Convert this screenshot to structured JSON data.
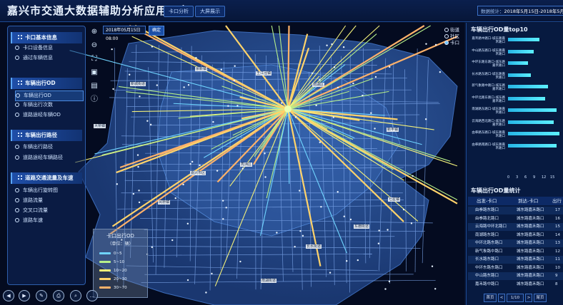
{
  "header": {
    "title": "嘉兴市交通大数据辅助分析应用平台",
    "buttons": [
      "卡口分析",
      "大屏展示"
    ],
    "stats_label": "数据统计：",
    "stats_value": "2018年5月15日-2018年5月21日"
  },
  "sidebar": {
    "sections": [
      {
        "title": "卡口基本信息",
        "items": [
          "卡口设备信息",
          "通过车辆信息"
        ]
      },
      {
        "title": "车辆出行OD",
        "items": [
          "车辆出行OD",
          "车辆出行次数",
          "道路途经车辆OD"
        ]
      },
      {
        "title": "车辆出行路径",
        "items": [
          "车辆出行路径",
          "道路途经车辆路径"
        ]
      },
      {
        "title": "道路交通流量及车速",
        "items": [
          "车辆出行旋转图",
          "道路流量",
          "交叉口流量",
          "道路车速"
        ]
      }
    ],
    "active_item": "车辆出行OD"
  },
  "toolbar": {
    "tools": [
      "zoom-in-icon",
      "zoom-out-icon",
      "fullscreen-icon",
      "image-icon",
      "document-icon",
      "info-icon"
    ]
  },
  "time_picker": {
    "value": "2018年05月15日08:00",
    "confirm_label": "确定"
  },
  "map": {
    "radio_options": [
      "街道",
      "社区",
      "卡口"
    ],
    "radio_selected": "卡口",
    "labels": [
      "余新镇",
      "王江泾镇",
      "新城街道",
      "南湖区",
      "大桥镇",
      "新丰镇",
      "秀洲区",
      "嘉兴市区",
      "凤桥镇",
      "七星镇",
      "东栅街道",
      "长水街道",
      "南湖街道"
    ]
  },
  "legend": {
    "title": "卡口出行OD",
    "unit": "（单位：辆）",
    "items": [
      {
        "label": "0~5",
        "color": "#6fd4ff"
      },
      {
        "label": "5~10",
        "color": "#b6f08a"
      },
      {
        "label": "10~20",
        "color": "#f2f07a"
      },
      {
        "label": "20~30",
        "color": "#ffd36a"
      },
      {
        "label": "30~70",
        "color": "#ffb26a"
      }
    ]
  },
  "bottom_controls": [
    "prev-icon",
    "play-icon",
    "edit-icon",
    "print-icon",
    "search-icon",
    "more-icon"
  ],
  "top10_panel": {
    "title": "车辆出行OD量top10"
  },
  "chart_data": {
    "type": "bar",
    "orientation": "horizontal",
    "title": "车辆出行OD量top10",
    "categories": [
      "嘉禾路中路口-城东路嘉禾路口",
      "中山路东路口-城东路嘉禾路口",
      "中环东路东路口-城东路嘉禾路口",
      "长水路东路口-城东路嘉禾路口",
      "新气象路中路口-城东路嘉禾路口",
      "中环北路东路口-城东路嘉禾路口",
      "南湖路东路口-城东路嘉禾路口",
      "云海路西北路口-城东路嘉禾路口",
      "由拳路东路口-城东路嘉禾路口",
      "由拳路南路口-城东路嘉禾路口"
    ],
    "values": [
      11,
      9,
      7,
      8,
      14,
      13,
      17,
      16,
      18,
      17
    ],
    "xticks": [
      "0",
      "3",
      "6",
      "9",
      "12",
      "15"
    ],
    "xlim": [
      0,
      18
    ]
  },
  "od_table": {
    "title": "车辆出行OD量统计",
    "columns": [
      "出发-卡口",
      "到达-卡口",
      "出行"
    ],
    "rows": [
      [
        "由拳路东路口",
        "城东路嘉禾路口",
        "17"
      ],
      [
        "由拳路北路口",
        "城东路嘉禾路口",
        "16"
      ],
      [
        "云海路中环北路口",
        "城东路嘉禾路口",
        "15"
      ],
      [
        "南湖路东路口",
        "城东路嘉禾路口",
        "14"
      ],
      [
        "中环北路东路口",
        "城东路嘉禾路口",
        "13"
      ],
      [
        "新气象路中路口",
        "城东路嘉禾路口",
        "12"
      ],
      [
        "长水路东路口",
        "城东路嘉禾路口",
        "11"
      ],
      [
        "中环东路东路口",
        "城东路嘉禾路口",
        "10"
      ],
      [
        "中山路东路口",
        "城东路嘉禾路口",
        "9"
      ],
      [
        "嘉禾路中路口",
        "城东路嘉禾路口",
        "8"
      ]
    ],
    "pager": {
      "first": "首页",
      "prev": "<",
      "page": "1/10",
      "next": ">",
      "last": "尾页"
    }
  }
}
